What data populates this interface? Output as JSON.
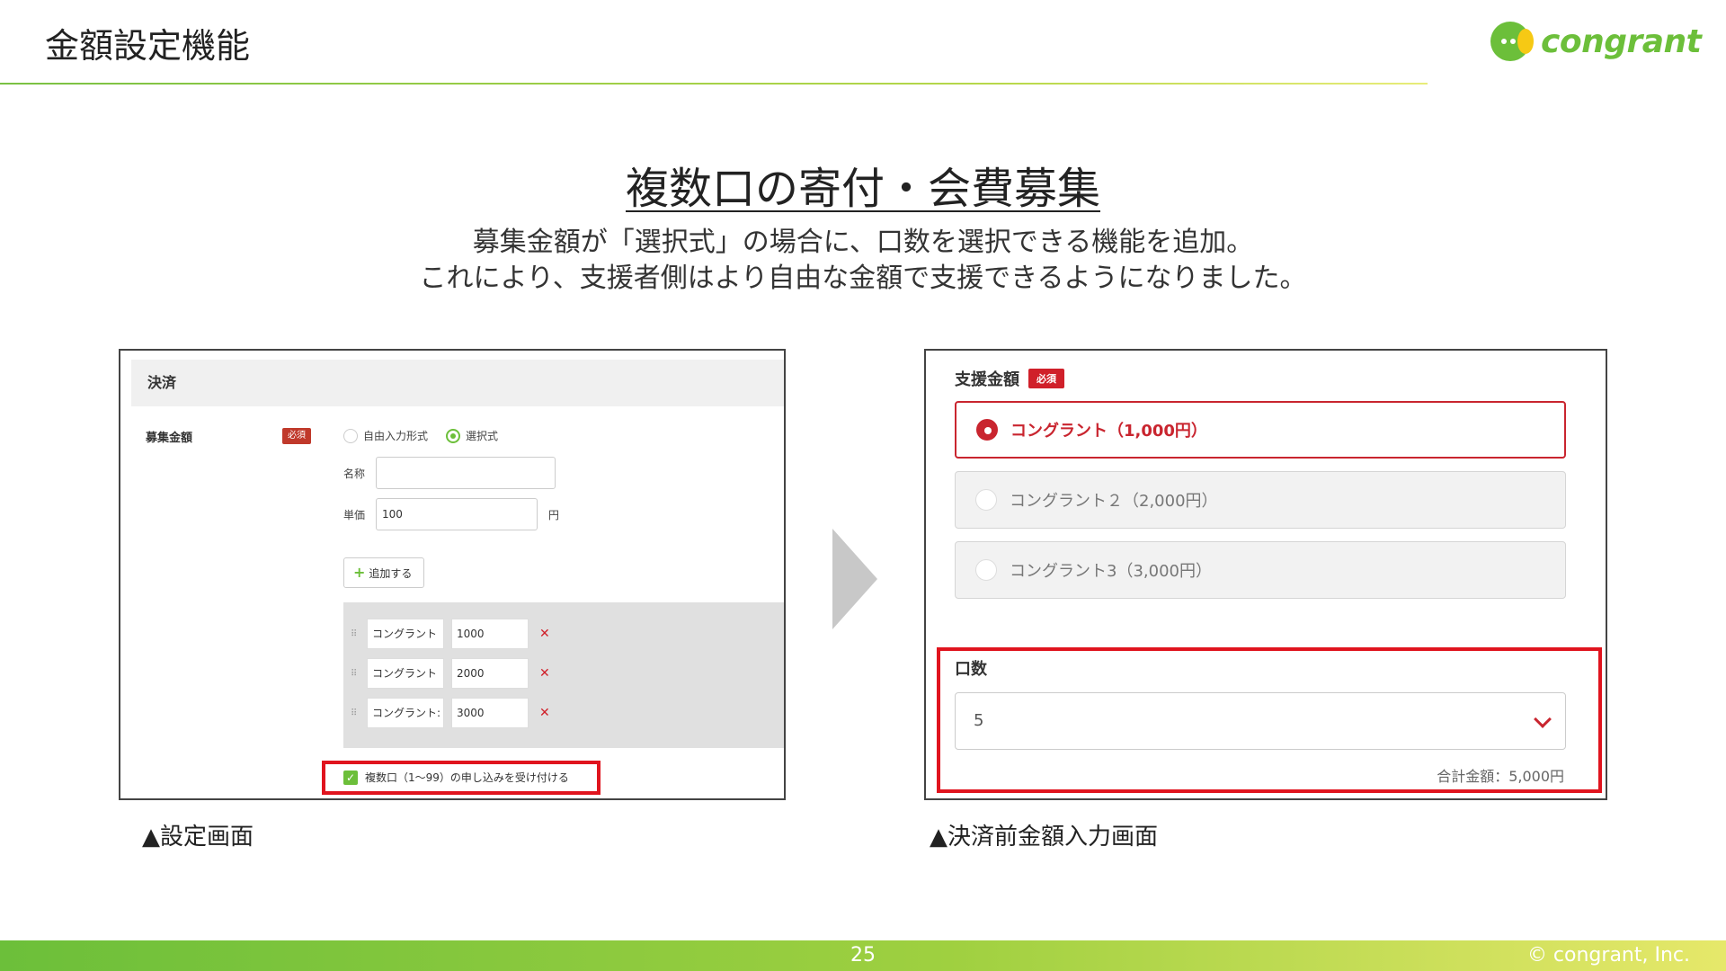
{
  "header": {
    "title": "金額設定機能",
    "logo_text": "congrant"
  },
  "headline": {
    "title": "複数口の寄付・会費募集",
    "desc_line1": "募集金額が「選択式」の場合に、口数を選択できる機能を追加。",
    "desc_line2": "これにより、支援者側はより自由な金額で支援できるようになりました。"
  },
  "left_panel": {
    "section_title": "決済",
    "field_label": "募集金額",
    "required_badge": "必須",
    "radio_free": "自由入力形式",
    "radio_select": "選択式",
    "name_label": "名称",
    "name_value": "",
    "price_label": "単価",
    "price_value": "100",
    "price_unit": "円",
    "add_button": "追加する",
    "options": [
      {
        "name": "コングラント",
        "value": "1000"
      },
      {
        "name": "コングラント",
        "value": "2000"
      },
      {
        "name": "コングラント:",
        "value": "3000"
      }
    ],
    "checkbox_label": "複数口（1〜99）の申し込みを受け付ける"
  },
  "captions": {
    "left": "▲設定画面",
    "right": "▲決済前金額入力画面"
  },
  "right_panel": {
    "field_label": "支援金額",
    "required_badge": "必須",
    "choices": [
      {
        "label": "コングラント（1,000円）",
        "selected": true
      },
      {
        "label": "コングラント２（2,000円）",
        "selected": false
      },
      {
        "label": "コングラント3（3,000円）",
        "selected": false
      }
    ],
    "quantity_label": "口数",
    "quantity_value": "5",
    "total": "合計金額：5,000円"
  },
  "footer": {
    "page_number": "25",
    "copyright": "© congrant, Inc."
  },
  "colors": {
    "brand_green": "#6cbf3a",
    "brand_yellow": "#f6c914",
    "highlight_red": "#e0141e",
    "accent_red": "#c9252f"
  }
}
